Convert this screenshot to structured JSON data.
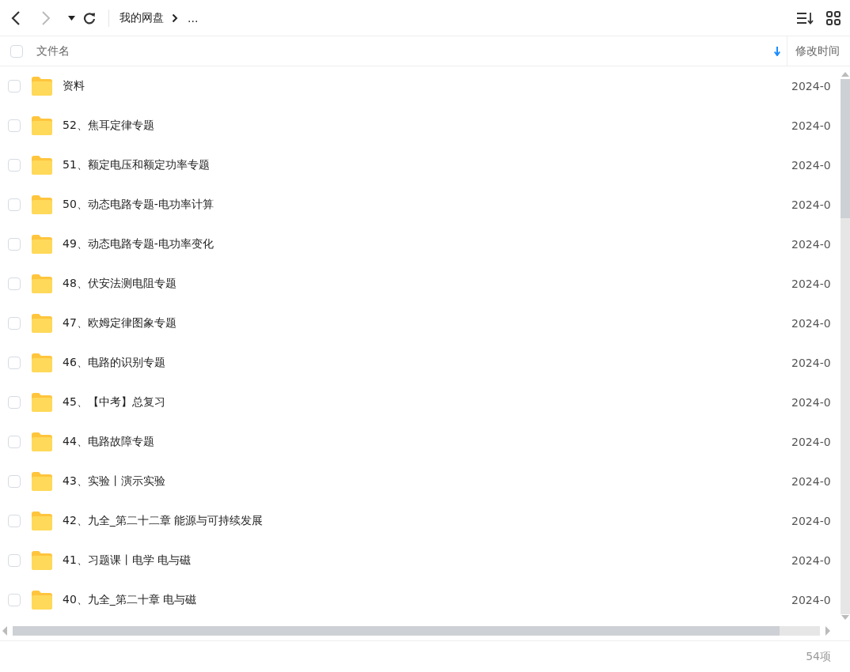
{
  "toolbar": {
    "breadcrumb": "我的网盘",
    "breadcrumb_more": "..."
  },
  "table": {
    "select_all_checked": false,
    "columns": [
      {
        "label": "文件名",
        "sorted": true
      },
      {
        "label": "修改时间",
        "sorted": false
      }
    ],
    "rows": [
      {
        "name": "资料",
        "modified": "2024-0",
        "checked": false
      },
      {
        "name": "52、焦耳定律专题",
        "modified": "2024-0",
        "checked": false
      },
      {
        "name": "51、额定电压和额定功率专题",
        "modified": "2024-0",
        "checked": false
      },
      {
        "name": "50、动态电路专题-电功率计算",
        "modified": "2024-0",
        "checked": false
      },
      {
        "name": "49、动态电路专题-电功率变化",
        "modified": "2024-0",
        "checked": false
      },
      {
        "name": "48、伏安法测电阻专题",
        "modified": "2024-0",
        "checked": false
      },
      {
        "name": "47、欧姆定律图象专题",
        "modified": "2024-0",
        "checked": false
      },
      {
        "name": "46、电路的识别专题",
        "modified": "2024-0",
        "checked": false
      },
      {
        "name": "45、【中考】总复习",
        "modified": "2024-0",
        "checked": false
      },
      {
        "name": "44、电路故障专题",
        "modified": "2024-0",
        "checked": false
      },
      {
        "name": "43、实验丨演示实验",
        "modified": "2024-0",
        "checked": false
      },
      {
        "name": "42、九全_第二十二章 能源与可持续发展",
        "modified": "2024-0",
        "checked": false
      },
      {
        "name": "41、习题课丨电学 电与磁",
        "modified": "2024-0",
        "checked": false
      },
      {
        "name": "40、九全_第二十章 电与磁",
        "modified": "2024-0",
        "checked": false
      }
    ]
  },
  "status_bar": {
    "count": "54项"
  }
}
